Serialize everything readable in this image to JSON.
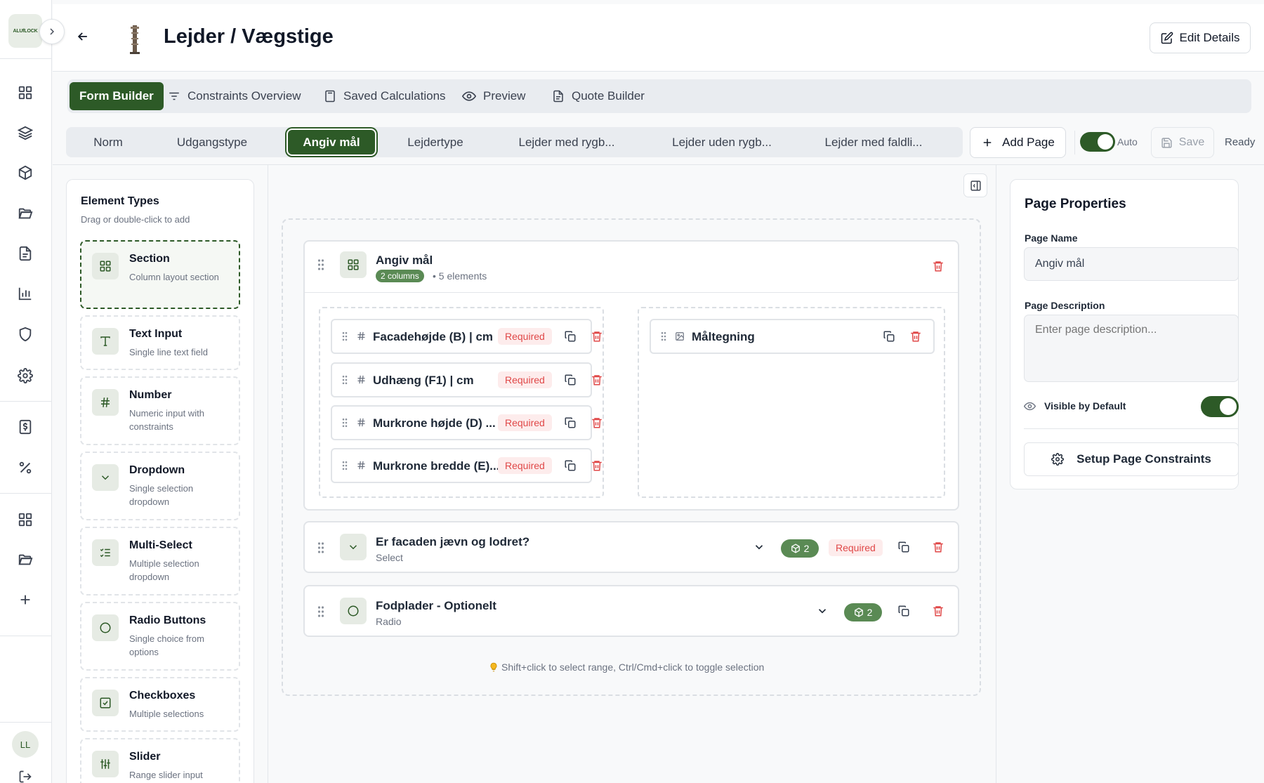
{
  "app": {
    "logo_text": "ALUfLOCK",
    "user_initials": "LL"
  },
  "header": {
    "title": "Lejder / Vægstige",
    "edit_label": "Edit Details"
  },
  "main_tabs": [
    {
      "label": "Form Builder",
      "active": true
    },
    {
      "label": "Constraints Overview"
    },
    {
      "label": "Saved Calculations"
    },
    {
      "label": "Preview"
    },
    {
      "label": "Quote Builder"
    }
  ],
  "page_tabs": [
    {
      "label": "Norm"
    },
    {
      "label": "Udgangstype"
    },
    {
      "label": "Angiv mål",
      "active": true
    },
    {
      "label": "Lejdertype"
    },
    {
      "label": "Lejder med rygb..."
    },
    {
      "label": "Lejder uden rygb..."
    },
    {
      "label": "Lejder med faldli..."
    }
  ],
  "toolbar": {
    "add_page_label": "Add Page",
    "auto_label": "Auto",
    "auto_enabled": true,
    "save_label": "Save",
    "status": "Ready"
  },
  "element_types": {
    "title": "Element Types",
    "subtitle": "Drag or double-click to add",
    "items": [
      {
        "name": "Section",
        "desc": "Column layout section",
        "icon": "grid-icon"
      },
      {
        "name": "Text Input",
        "desc": "Single line text field",
        "icon": "text-icon"
      },
      {
        "name": "Number",
        "desc": "Numeric input with constraints",
        "icon": "hash-icon"
      },
      {
        "name": "Dropdown",
        "desc": "Single selection dropdown",
        "icon": "chevron-down-icon"
      },
      {
        "name": "Multi-Select",
        "desc": "Multiple selection dropdown",
        "icon": "list-check-icon"
      },
      {
        "name": "Radio Buttons",
        "desc": "Single choice from options",
        "icon": "circle-icon"
      },
      {
        "name": "Checkboxes",
        "desc": "Multiple selections",
        "icon": "checkbox-icon"
      },
      {
        "name": "Slider",
        "desc": "Range slider input",
        "icon": "sliders-icon"
      }
    ]
  },
  "canvas": {
    "section": {
      "title": "Angiv mål",
      "columns_badge": "2 columns",
      "elements_text": "• 5 elements",
      "left_column": [
        {
          "label": "Facadehøjde (B) | cm",
          "required": "Required"
        },
        {
          "label": "Udhæng (F1) | cm",
          "required": "Required"
        },
        {
          "label": "Murkrone højde (D) ...",
          "required": "Required"
        },
        {
          "label": "Murkrone bredde (E)...",
          "required": "Required"
        }
      ],
      "right_column": [
        {
          "label": "Måltegning"
        }
      ]
    },
    "rows": [
      {
        "title": "Er facaden jævn og lodret?",
        "type": "Select",
        "count": "2",
        "required": "Required"
      },
      {
        "title": "Fodplader - Optionelt",
        "type": "Radio",
        "count": "2"
      }
    ],
    "hint": "Shift+click to select range, Ctrl/Cmd+click to toggle selection"
  },
  "properties": {
    "title": "Page Properties",
    "name_label": "Page Name",
    "name_value": "Angiv mål",
    "desc_label": "Page Description",
    "desc_placeholder": "Enter page description...",
    "visible_label": "Visible by Default",
    "visible_enabled": true,
    "setup_label": "Setup Page Constraints"
  },
  "colors": {
    "accent": "#2d5a27",
    "badge": "#5a8a54",
    "danger": "#e04848"
  }
}
